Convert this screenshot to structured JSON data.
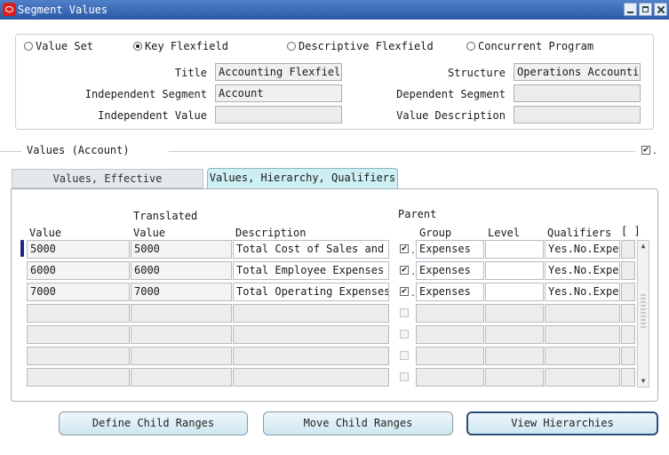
{
  "window": {
    "title": "Segment Values"
  },
  "radios": [
    {
      "label": "Value Set",
      "selected": false
    },
    {
      "label": "Key Flexfield",
      "selected": true
    },
    {
      "label": "Descriptive Flexfield",
      "selected": false
    },
    {
      "label": "Concurrent Program",
      "selected": false
    }
  ],
  "form": {
    "title_label": "Title",
    "title_value": "Accounting Flexfield",
    "structure_label": "Structure",
    "structure_value": "Operations Accountin",
    "indep_segment_label": "Independent Segment",
    "indep_segment_value": "Account",
    "dep_segment_label": "Dependent Segment",
    "dep_segment_value": "",
    "indep_value_label": "Independent Value",
    "indep_value_value": "",
    "value_desc_label": "Value Description",
    "value_desc_value": ""
  },
  "values_section": {
    "title": "Values (Account)",
    "dot": "."
  },
  "tabs": [
    {
      "label": "Values, Effective",
      "active": false
    },
    {
      "label": "Values, Hierarchy, Qualifiers",
      "active": true
    }
  ],
  "table": {
    "headers": {
      "value": "Value",
      "translated": "Translated",
      "translated_value": "Value",
      "description": "Description",
      "parent": "Parent",
      "group": "Group",
      "level": "Level",
      "qualifiers": "Qualifiers",
      "extra": "[ ]"
    },
    "rows": [
      {
        "value": "5000",
        "translated": "5000",
        "description": "Total Cost of Sales and S",
        "parent": true,
        "group": "Expenses",
        "level": "",
        "qualifiers": "Yes.No.Exper"
      },
      {
        "value": "6000",
        "translated": "6000",
        "description": "Total Employee Expenses",
        "parent": true,
        "group": "Expenses",
        "level": "",
        "qualifiers": "Yes.No.Exper"
      },
      {
        "value": "7000",
        "translated": "7000",
        "description": "Total Operating Expenses",
        "parent": true,
        "group": "Expenses",
        "level": "",
        "qualifiers": "Yes.No.Exper"
      },
      {
        "value": "",
        "translated": "",
        "description": "",
        "parent": false,
        "group": "",
        "level": "",
        "qualifiers": ""
      },
      {
        "value": "",
        "translated": "",
        "description": "",
        "parent": false,
        "group": "",
        "level": "",
        "qualifiers": ""
      },
      {
        "value": "",
        "translated": "",
        "description": "",
        "parent": false,
        "group": "",
        "level": "",
        "qualifiers": ""
      },
      {
        "value": "",
        "translated": "",
        "description": "",
        "parent": false,
        "group": "",
        "level": "",
        "qualifiers": ""
      }
    ]
  },
  "buttons": {
    "define_child_ranges": "Define Child Ranges",
    "move_child_ranges": "Move Child Ranges",
    "view_hierarchies": "View Hierarchies"
  }
}
